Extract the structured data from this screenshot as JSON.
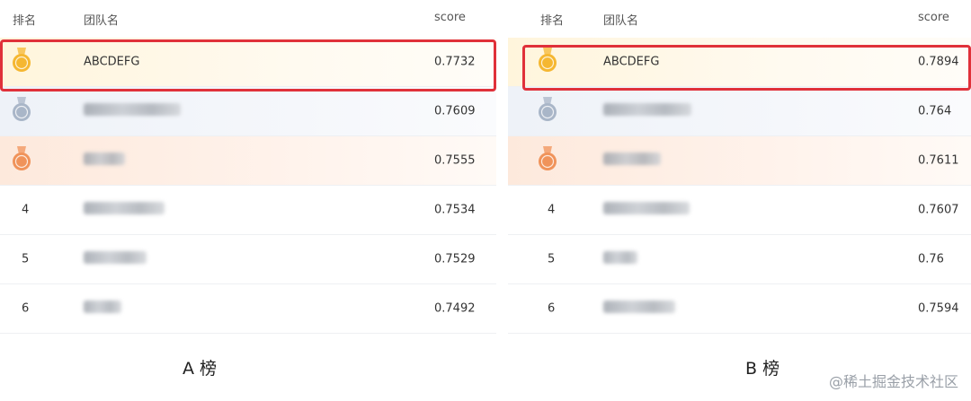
{
  "columns": {
    "rank": "排名",
    "team": "团队名",
    "score": "score"
  },
  "boards": [
    {
      "caption": "A 榜",
      "rows": [
        {
          "rank": "1",
          "medal": "gold",
          "team": "ABCDEFG",
          "score": "0.7732",
          "blurWidth": 0
        },
        {
          "rank": "2",
          "medal": "silver",
          "team": "",
          "score": "0.7609",
          "blurWidth": 108
        },
        {
          "rank": "3",
          "medal": "bronze",
          "team": "",
          "score": "0.7555",
          "blurWidth": 46
        },
        {
          "rank": "4",
          "medal": "",
          "team": "",
          "score": "0.7534",
          "blurWidth": 90
        },
        {
          "rank": "5",
          "medal": "",
          "team": "",
          "score": "0.7529",
          "blurWidth": 70
        },
        {
          "rank": "6",
          "medal": "",
          "team": "",
          "score": "0.7492",
          "blurWidth": 42
        }
      ]
    },
    {
      "caption": "B 榜",
      "rows": [
        {
          "rank": "1",
          "medal": "gold",
          "team": "ABCDEFG",
          "score": "0.7894",
          "blurWidth": 0
        },
        {
          "rank": "2",
          "medal": "silver",
          "team": "",
          "score": "0.764",
          "blurWidth": 98
        },
        {
          "rank": "3",
          "medal": "bronze",
          "team": "",
          "score": "0.7611",
          "blurWidth": 64
        },
        {
          "rank": "4",
          "medal": "",
          "team": "",
          "score": "0.7607",
          "blurWidth": 96
        },
        {
          "rank": "5",
          "medal": "",
          "team": "",
          "score": "0.76",
          "blurWidth": 38
        },
        {
          "rank": "6",
          "medal": "",
          "team": "",
          "score": "0.7594",
          "blurWidth": 80
        }
      ]
    }
  ],
  "watermark": "@稀土掘金技术社区",
  "colors": {
    "highlight": "#e0313a",
    "gold": "#f5b731",
    "silver": "#a9b6c8",
    "bronze": "#f0935a"
  }
}
